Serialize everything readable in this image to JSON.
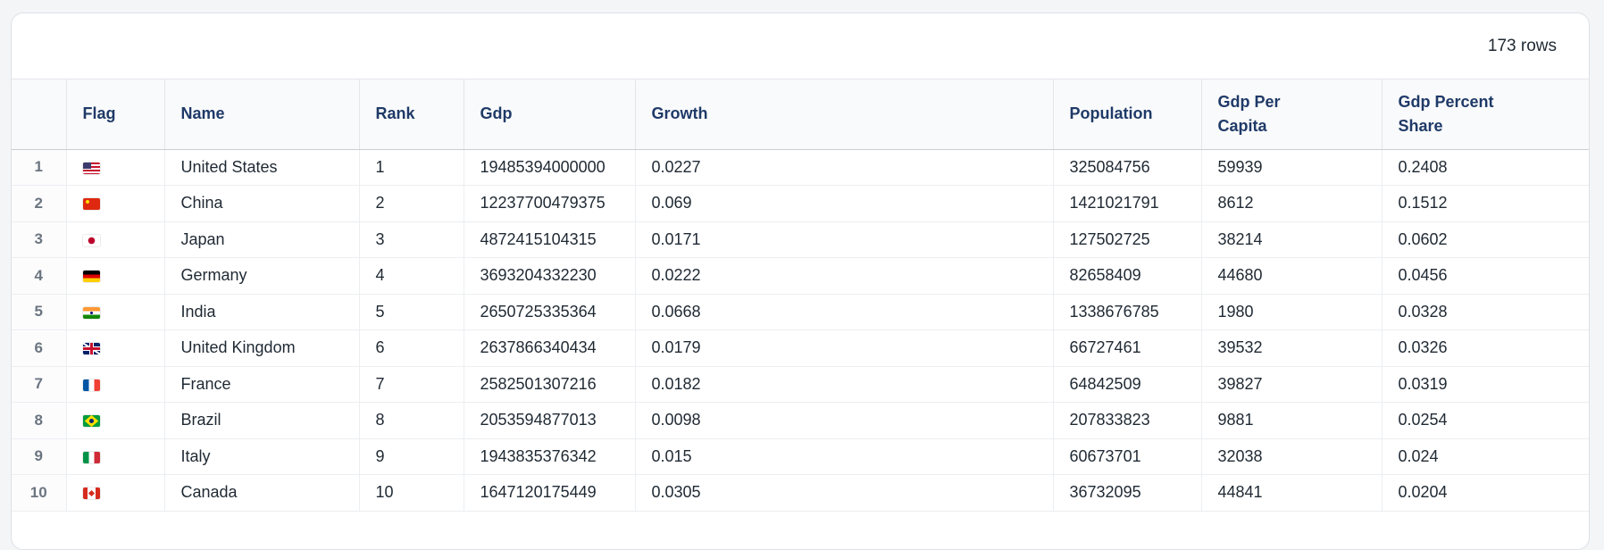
{
  "toolbar": {
    "row_count": "173 rows"
  },
  "table": {
    "columns": [
      "",
      "Flag",
      "Name",
      "Rank",
      "Gdp",
      "Growth",
      "Population",
      "Gdp Per Capita",
      "Gdp Percent Share"
    ],
    "rows": [
      {
        "index": "1",
        "flag": "flag-us",
        "name": "United States",
        "rank": "1",
        "gdp": "19485394000000",
        "growth": "0.0227",
        "population": "325084756",
        "gdp_per_capita": "59939",
        "gdp_percent_share": "0.2408"
      },
      {
        "index": "2",
        "flag": "flag-cn",
        "name": "China",
        "rank": "2",
        "gdp": "12237700479375",
        "growth": "0.069",
        "population": "1421021791",
        "gdp_per_capita": "8612",
        "gdp_percent_share": "0.1512"
      },
      {
        "index": "3",
        "flag": "flag-jp",
        "name": "Japan",
        "rank": "3",
        "gdp": "4872415104315",
        "growth": "0.0171",
        "population": "127502725",
        "gdp_per_capita": "38214",
        "gdp_percent_share": "0.0602"
      },
      {
        "index": "4",
        "flag": "flag-de",
        "name": "Germany",
        "rank": "4",
        "gdp": "3693204332230",
        "growth": "0.0222",
        "population": "82658409",
        "gdp_per_capita": "44680",
        "gdp_percent_share": "0.0456"
      },
      {
        "index": "5",
        "flag": "flag-in",
        "name": "India",
        "rank": "5",
        "gdp": "2650725335364",
        "growth": "0.0668",
        "population": "1338676785",
        "gdp_per_capita": "1980",
        "gdp_percent_share": "0.0328"
      },
      {
        "index": "6",
        "flag": "flag-gb",
        "name": "United Kingdom",
        "rank": "6",
        "gdp": "2637866340434",
        "growth": "0.0179",
        "population": "66727461",
        "gdp_per_capita": "39532",
        "gdp_percent_share": "0.0326"
      },
      {
        "index": "7",
        "flag": "flag-fr",
        "name": "France",
        "rank": "7",
        "gdp": "2582501307216",
        "growth": "0.0182",
        "population": "64842509",
        "gdp_per_capita": "39827",
        "gdp_percent_share": "0.0319"
      },
      {
        "index": "8",
        "flag": "flag-br",
        "name": "Brazil",
        "rank": "8",
        "gdp": "2053594877013",
        "growth": "0.0098",
        "population": "207833823",
        "gdp_per_capita": "9881",
        "gdp_percent_share": "0.0254"
      },
      {
        "index": "9",
        "flag": "flag-it",
        "name": "Italy",
        "rank": "9",
        "gdp": "1943835376342",
        "growth": "0.015",
        "population": "60673701",
        "gdp_per_capita": "32038",
        "gdp_percent_share": "0.024"
      },
      {
        "index": "10",
        "flag": "flag-ca",
        "name": "Canada",
        "rank": "10",
        "gdp": "1647120175449",
        "growth": "0.0305",
        "population": "36732095",
        "gdp_per_capita": "44841",
        "gdp_percent_share": "0.0204"
      }
    ]
  }
}
